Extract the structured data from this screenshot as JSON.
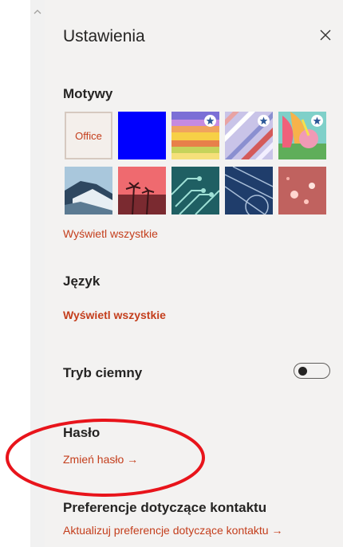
{
  "panel": {
    "title": "Ustawienia",
    "close_icon": "close-icon"
  },
  "themes": {
    "label": "Motywy",
    "office_tile_label": "Office",
    "view_all": "Wyświetl wszystkie",
    "tiles": [
      {
        "name": "office",
        "color": "#f4efeb"
      },
      {
        "name": "blue",
        "color": "#0000ff"
      },
      {
        "name": "rainbow",
        "starred": true
      },
      {
        "name": "diagonal-stripes",
        "starred": true
      },
      {
        "name": "unicorn",
        "starred": true
      },
      {
        "name": "mountain"
      },
      {
        "name": "palm-trees"
      },
      {
        "name": "circuit"
      },
      {
        "name": "aviation"
      },
      {
        "name": "bokeh"
      }
    ]
  },
  "language": {
    "label": "Język",
    "view_all": "Wyświetl wszystkie"
  },
  "dark_mode": {
    "label": "Tryb ciemny",
    "enabled": false
  },
  "password": {
    "label": "Hasło",
    "change_link": "Zmień hasło →"
  },
  "contact": {
    "label": "Preferencje dotyczące kontaktu",
    "update_link": "Aktualizuj preferencje dotyczące kontaktu →"
  },
  "colors": {
    "accent": "#c43e1c",
    "panel_bg": "#f3f2f1",
    "annotation": "#e8141b"
  }
}
